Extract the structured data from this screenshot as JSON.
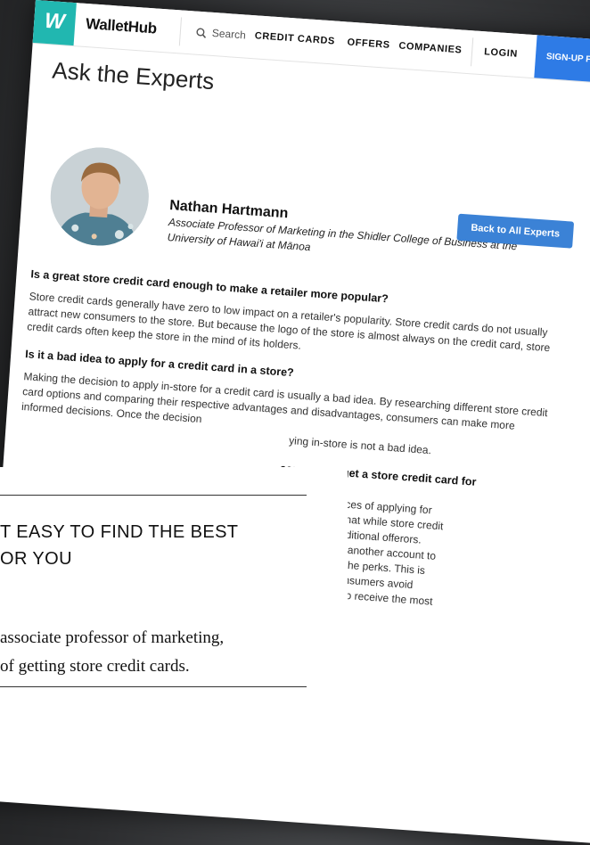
{
  "nav": {
    "logo_letter": "W",
    "brand": "WalletHub",
    "search_label": "Search",
    "links": [
      "CREDIT CARDS",
      "OFFERS",
      "COMPANIES"
    ],
    "login": "LOGIN",
    "signup": "SIGN-UP F"
  },
  "page": {
    "title": "Ask the Experts"
  },
  "expert": {
    "name": "Nathan Hartmann",
    "title": "Associate Professor of Marketing in the Shidler College of Business at the University of Hawai'i at Mānoa",
    "back_button": "Back to All Experts"
  },
  "qa": [
    {
      "q": "Is a great store credit card enough to make a retailer more popular?",
      "a": "Store credit cards generally have zero to low impact on a retailer's popularity. Store credit cards do not usually attract new consumers to the store. But because the logo of the store is almost always on the credit card, store credit cards often keep the store in the mind of its holders."
    },
    {
      "q": "Is it a bad idea to apply for a credit card in a store?",
      "a": "Making the decision to apply in-store for a credit card is usually a bad idea. By researching different store credit card options and comparing their respective advantages and disadvantages, consumers can make more informed decisions. Once the decision"
    }
  ],
  "fragments": {
    "a2_end": "ying in-store is not a bad idea.",
    "q3_partial": "consumers get a store credit card for",
    "lines": [
      "r the consequences of applying for",
      "d also consider that while store credit",
      "ss perks than traditional offerors.",
      "t card, they have another account to",
      "worth more than the perks. This is",
      "erally suggest consumers avoid",
      "at they are likely to receive the most"
    ]
  },
  "overlay": {
    "headline_1": "T EASY TO FIND THE BEST",
    "headline_2": "OR YOU",
    "text_1": "associate professor of marketing,",
    "text_2": "of getting store credit cards."
  }
}
